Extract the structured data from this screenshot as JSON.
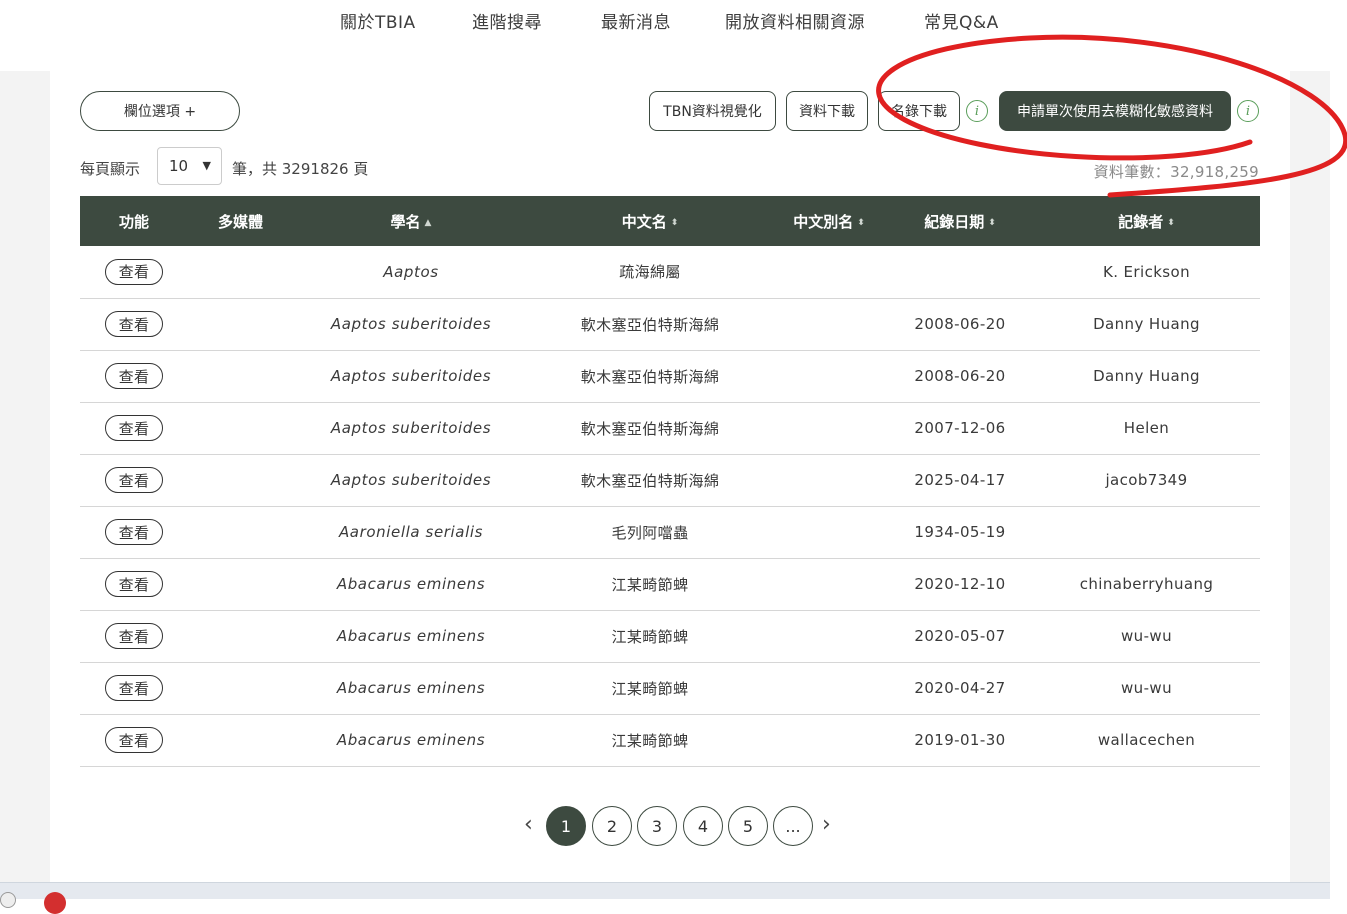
{
  "nav": [
    {
      "label": "關於TBIA"
    },
    {
      "label": "進階搜尋"
    },
    {
      "label": "最新消息"
    },
    {
      "label": "開放資料相關資源"
    },
    {
      "label": "常見Q&A"
    }
  ],
  "toolbar": {
    "columns_label": "欄位選項 +",
    "tbn_label": "TBN資料視覺化",
    "download_label": "資料下載",
    "list_download_label": "名錄下載",
    "apply_label": "申請單次使用去模糊化敏感資料",
    "info_icon": "info-icon"
  },
  "paging": {
    "per_page_label": "每頁顯示",
    "per_page_value": "10",
    "pages_text": "筆，共 3291826 頁",
    "total_text": "資料筆數：32,918,259"
  },
  "table": {
    "headers": [
      "功能",
      "多媒體",
      "學名",
      "中文名",
      "中文別名",
      "紀錄日期",
      "記錄者"
    ],
    "sort_icons": {
      "asc": "▲",
      "both": "⬍"
    },
    "view_label": "查看",
    "rows": [
      {
        "sci": "Aaptos",
        "zh": "疏海綿屬",
        "alias": "",
        "date": "",
        "recorder": "K. Erickson"
      },
      {
        "sci": "Aaptos suberitoides",
        "zh": "軟木塞亞伯特斯海綿",
        "alias": "",
        "date": "2008-06-20",
        "recorder": "Danny Huang"
      },
      {
        "sci": "Aaptos suberitoides",
        "zh": "軟木塞亞伯特斯海綿",
        "alias": "",
        "date": "2008-06-20",
        "recorder": "Danny Huang"
      },
      {
        "sci": "Aaptos suberitoides",
        "zh": "軟木塞亞伯特斯海綿",
        "alias": "",
        "date": "2007-12-06",
        "recorder": "Helen"
      },
      {
        "sci": "Aaptos suberitoides",
        "zh": "軟木塞亞伯特斯海綿",
        "alias": "",
        "date": "2025-04-17",
        "recorder": "jacob7349"
      },
      {
        "sci": "Aaroniella serialis",
        "zh": "毛列阿噹蟲",
        "alias": "",
        "date": "1934-05-19",
        "recorder": ""
      },
      {
        "sci": "Abacarus eminens",
        "zh": "江某畸節蜱",
        "alias": "",
        "date": "2020-12-10",
        "recorder": "chinaberryhuang"
      },
      {
        "sci": "Abacarus eminens",
        "zh": "江某畸節蜱",
        "alias": "",
        "date": "2020-05-07",
        "recorder": "wu-wu"
      },
      {
        "sci": "Abacarus eminens",
        "zh": "江某畸節蜱",
        "alias": "",
        "date": "2020-04-27",
        "recorder": "wu-wu"
      },
      {
        "sci": "Abacarus eminens",
        "zh": "江某畸節蜱",
        "alias": "",
        "date": "2019-01-30",
        "recorder": "wallacechen"
      }
    ]
  },
  "pagination": {
    "prev": "‹",
    "next": "›",
    "pages": [
      "1",
      "2",
      "3",
      "4",
      "5",
      "..."
    ],
    "current": "1"
  },
  "colors": {
    "brand_dark": "#3d4a40",
    "info_green": "#5a9e5a",
    "annotation_red": "#e02020"
  }
}
